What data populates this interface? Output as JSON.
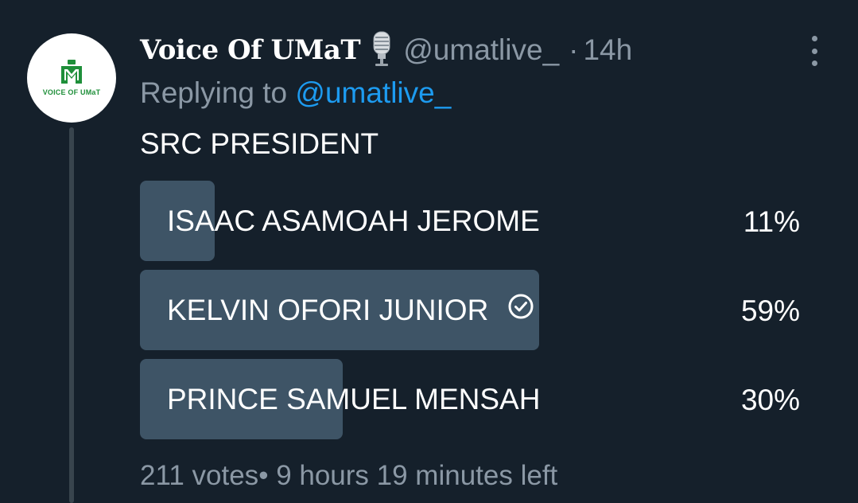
{
  "tweet": {
    "display_name": "Voice Of UMaT",
    "name_emoji": "studio-microphone-icon",
    "handle": "@umatlive_",
    "separator": "·",
    "time": "14h",
    "reply_prefix": "Replying to ",
    "reply_to": "@umatlive_",
    "text": "SRC PRESIDENT",
    "avatar": {
      "logo_text": "VOICE OF UMaT",
      "logo_color": "#1f8f3a"
    }
  },
  "poll": {
    "options": [
      {
        "label": "ISAAC ASAMOAH JEROME",
        "percent_text": "11%",
        "percent": 11,
        "selected": false
      },
      {
        "label": "KELVIN OFORI JUNIOR",
        "percent_text": "59%",
        "percent": 59,
        "selected": true
      },
      {
        "label": "PRINCE SAMUEL MENSAH",
        "percent_text": "30%",
        "percent": 30,
        "selected": false
      }
    ],
    "votes": "211 votes",
    "bullet": "•",
    "time_left": "9 hours 19 minutes left"
  },
  "colors": {
    "background": "#15202b",
    "bar": "#3e5466",
    "secondary_text": "#8b98a5",
    "link": "#1d9bf0",
    "thread_line": "#38444d"
  }
}
